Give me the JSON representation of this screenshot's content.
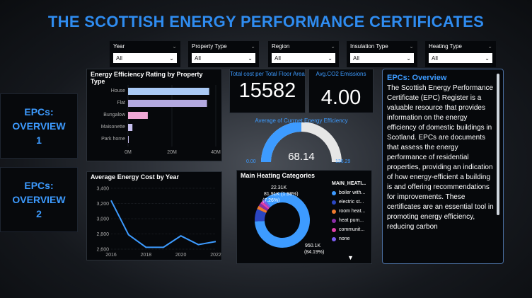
{
  "title": "THE SCOTTISH ENERGY PERFORMANCE CERTIFICATES",
  "nav": {
    "overview1": "EPCs: OVERVIEW 1",
    "overview2": "EPCs: OVERVIEW 2"
  },
  "filters": [
    {
      "label": "Year",
      "value": "All"
    },
    {
      "label": "Property Type",
      "value": "All"
    },
    {
      "label": "Region",
      "value": "All"
    },
    {
      "label": "Insulation Type",
      "value": "All"
    },
    {
      "label": "Heating Type",
      "value": "All"
    }
  ],
  "kpis": {
    "total_cost_label": "Total cost per Total Floor Area",
    "total_cost_value": "15582",
    "co2_label": "Avg.CO2 Emissions",
    "co2_value": "4.00"
  },
  "gauge": {
    "title": "Average of Currnet Energy Efficiency",
    "value": "68.14",
    "min": "0.00",
    "max": "136.29",
    "fraction": 0.5
  },
  "overview": {
    "title": "EPCs: Overview",
    "text": "The Scottish Energy Performance Certificate (EPC) Register is a valuable resource that provides information on the energy efficiency of domestic buildings in Scotland. EPCs are documents that assess the energy performance of residential properties, providing an indication of how energy-efficient a building is and offering recommendations for improvements. These certificates are an essential tool in promoting energy efficiency, reducing carbon"
  },
  "icons": {
    "dropdown": "chevron-down-icon",
    "scroll_down": "triangle-down-icon",
    "expand": "expand-icon"
  },
  "colors": {
    "accent": "#3d9bff",
    "title": "#2f8cf0"
  },
  "charts": {
    "rating": {
      "title": "Energy Efficiency Rating by Property Type",
      "xticks": [
        "0M",
        "20M",
        "40M"
      ]
    },
    "cost": {
      "title": "Average Energy Cost by Year",
      "yticks": [
        "3,400",
        "3,200",
        "3,000",
        "2,800",
        "2,600"
      ],
      "xticks": [
        "2016",
        "2018",
        "2020",
        "2022"
      ]
    },
    "heating": {
      "title": "Main Heating Categories",
      "legend_title": "MAIN_HEATI...",
      "legend": [
        "boiler with...",
        "electric st...",
        "room heat...",
        "heat pum...",
        "communit...",
        "none"
      ],
      "labels": {
        "big": "950.1K",
        "big_pct": "(84.19%)",
        "l1": "81.91K (1.98%)",
        "l1b": "(7.26%)",
        "l2": "22.31K"
      }
    }
  },
  "chart_data": [
    {
      "type": "bar",
      "title": "Energy Efficiency Rating by Property Type",
      "categories": [
        "House",
        "Flat",
        "Bungalow",
        "Maisonette",
        "Park home"
      ],
      "values": [
        37000000,
        36000000,
        9000000,
        2000000,
        100000
      ],
      "xlim": [
        0,
        40000000
      ],
      "orientation": "horizontal",
      "colors": [
        "#a9c9f5",
        "#b3a9e0",
        "#f0a8d6",
        "#c8c0f0",
        "#c8c0f0"
      ]
    },
    {
      "type": "line",
      "title": "Average Energy Cost by Year",
      "x": [
        2016,
        2017,
        2018,
        2019,
        2020,
        2021,
        2022
      ],
      "values": [
        3240,
        2790,
        2625,
        2625,
        2775,
        2660,
        2700
      ],
      "ylim": [
        2600,
        3400
      ],
      "xlim": [
        2016,
        2022
      ]
    },
    {
      "type": "pie",
      "title": "Main Heating Categories",
      "donut": true,
      "categories": [
        "boiler with...",
        "electric st...",
        "room heat...",
        "heat pum...",
        "communit...",
        "none"
      ],
      "values": [
        950.1,
        81.91,
        22.31,
        20,
        18,
        16
      ],
      "colors": [
        "#3d9bff",
        "#2b46c2",
        "#f07a2e",
        "#8a2da8",
        "#e23fa8",
        "#7a5cf0"
      ]
    }
  ]
}
